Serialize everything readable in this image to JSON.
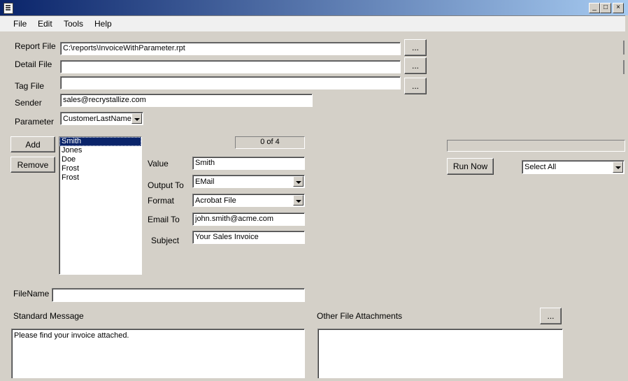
{
  "window": {
    "title": "",
    "min_label": "_",
    "max_label": "□",
    "close_label": "×"
  },
  "menu": {
    "items": [
      "File",
      "Edit",
      "Tools",
      "Help"
    ]
  },
  "form": {
    "report_file_label": "Report File",
    "report_file_value": "C:\\reports\\InvoiceWithParameter.rpt",
    "detail_file_label": "Detail File",
    "detail_file_value": "",
    "tag_file_label": "Tag File",
    "tag_file_value": "",
    "browse_label": "...",
    "sender_label": "Sender",
    "sender_value": "sales@recrystallize.com",
    "parameter_label": "Parameter",
    "parameter_value": "CustomerLastName"
  },
  "actions": {
    "add_label": "Add",
    "remove_label": "Remove",
    "run_now_label": "Run Now"
  },
  "parameter_list": {
    "items": [
      "Smith",
      "Jones",
      "Doe",
      "Frost",
      "Frost"
    ],
    "selected_index": 0
  },
  "record_counter": "0 of 4",
  "select_all": {
    "value": "Select All"
  },
  "progress": {
    "fraction": 0
  },
  "details": {
    "value_label": "Value",
    "value": "Smith",
    "output_to_label": "Output To",
    "output_to_value": "EMail",
    "format_label": "Format",
    "format_value": "Acrobat File",
    "email_to_label": "Email To",
    "email_to_value": "john.smith@acme.com",
    "subject_label": "Subject",
    "subject_value": "Your Sales Invoice"
  },
  "filename": {
    "label": "FileName",
    "value": ""
  },
  "standard_message": {
    "label": "Standard Message",
    "value": "Please find your invoice attached."
  },
  "attachments": {
    "label": "Other File Attachments",
    "browse_label": "..."
  },
  "colors": {
    "face": "#d4d0c8",
    "selection": "#0a246a",
    "title_start": "#0a246a",
    "title_end": "#a6caf0"
  }
}
